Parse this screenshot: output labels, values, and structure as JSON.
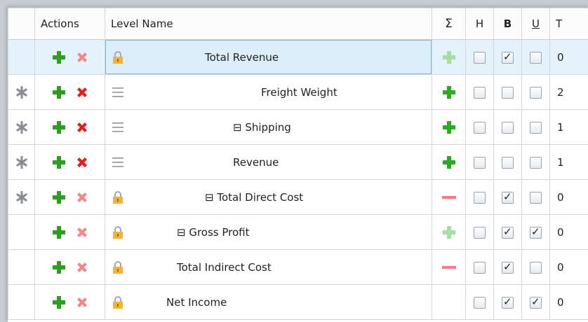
{
  "headers": {
    "actions": "Actions",
    "level_name": "Level Name",
    "sigma": "Σ",
    "h": "H",
    "b": "B",
    "u": "U",
    "t": "T"
  },
  "colors": {
    "add_active": "#2e9e22",
    "add_faded": "#6cc45f",
    "delete_active": "#e02020",
    "delete_faded": "#f08a8a",
    "plus_sigma": "#2eaa22",
    "plus_sigma_faded": "#a7dda0",
    "minus_sigma": "#f07c8a",
    "selected_row_bg": "#e6f2fb"
  },
  "rows": [
    {
      "level_name": "Total Revenue",
      "indent": 110,
      "marker": "",
      "lead_icon": "lock-icon",
      "star": false,
      "delete_active": false,
      "sigma": "plus-faded",
      "h": false,
      "b": true,
      "u": false,
      "t": "0",
      "selected": true
    },
    {
      "level_name": "Freight Weight",
      "indent": 190,
      "marker": "",
      "lead_icon": "drag-handle-icon",
      "star": true,
      "delete_active": true,
      "sigma": "plus",
      "h": false,
      "b": false,
      "u": false,
      "t": "2",
      "selected": false
    },
    {
      "level_name": "Shipping",
      "indent": 150,
      "marker": "⊟ ",
      "lead_icon": "drag-handle-icon",
      "star": true,
      "delete_active": true,
      "sigma": "plus",
      "h": false,
      "b": false,
      "u": false,
      "t": "1",
      "selected": false
    },
    {
      "level_name": "Revenue",
      "indent": 150,
      "marker": "",
      "lead_icon": "drag-handle-icon",
      "star": true,
      "delete_active": true,
      "sigma": "plus",
      "h": false,
      "b": false,
      "u": false,
      "t": "1",
      "selected": false
    },
    {
      "level_name": "Total Direct Cost",
      "indent": 110,
      "marker": "⊟ ",
      "lead_icon": "lock-icon",
      "star": true,
      "delete_active": false,
      "sigma": "minus",
      "h": false,
      "b": true,
      "u": false,
      "t": "0",
      "selected": false
    },
    {
      "level_name": "Gross Profit",
      "indent": 70,
      "marker": "⊟ ",
      "lead_icon": "lock-icon",
      "star": false,
      "delete_active": false,
      "sigma": "plus-faded",
      "h": false,
      "b": true,
      "u": true,
      "t": "0",
      "selected": false
    },
    {
      "level_name": "Total Indirect Cost",
      "indent": 70,
      "marker": "",
      "lead_icon": "lock-icon",
      "star": false,
      "delete_active": false,
      "sigma": "minus",
      "h": false,
      "b": true,
      "u": false,
      "t": "0",
      "selected": false
    },
    {
      "level_name": "Net Income",
      "indent": 55,
      "marker": "",
      "lead_icon": "lock-icon",
      "star": false,
      "delete_active": false,
      "sigma": "none",
      "h": false,
      "b": true,
      "u": true,
      "t": "0",
      "selected": false
    }
  ]
}
